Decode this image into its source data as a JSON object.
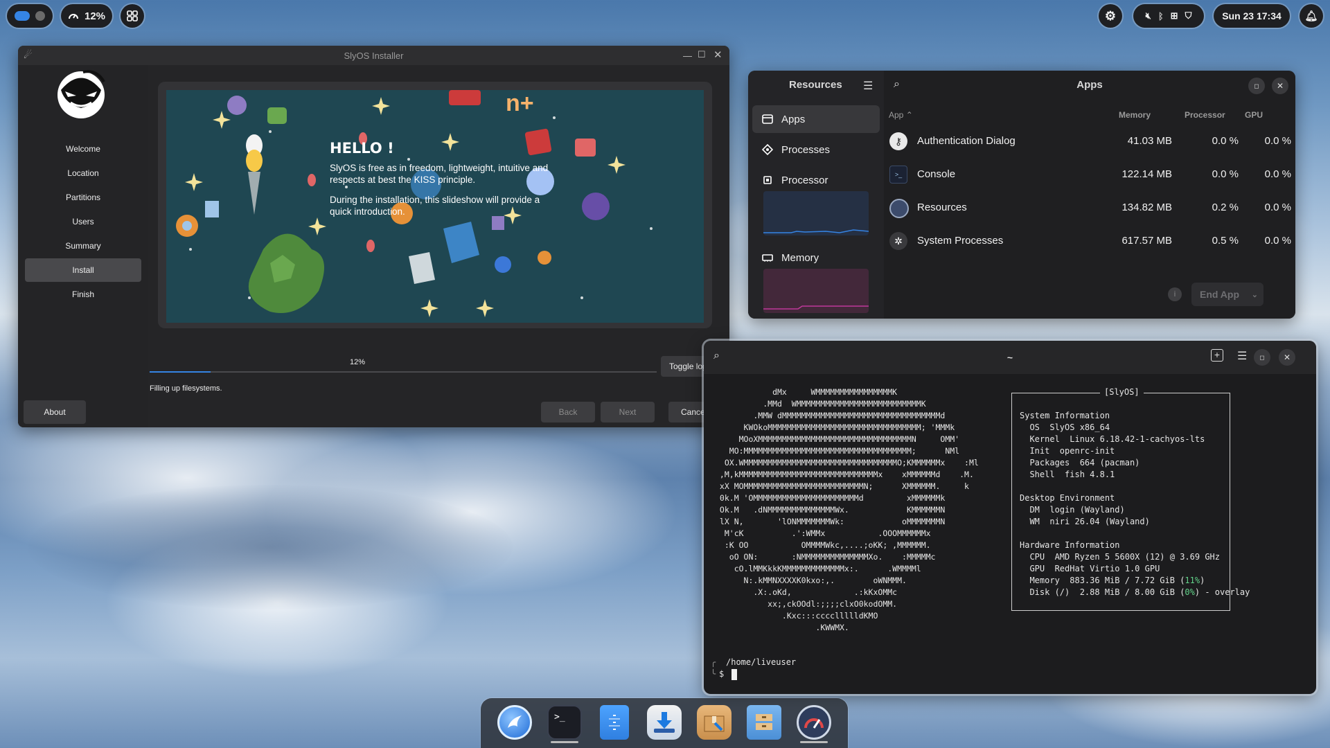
{
  "topbar": {
    "cpu_percent": "12%",
    "clock": "Sun 23 17:34"
  },
  "installer": {
    "title": "SlyOS Installer",
    "steps": [
      "Welcome",
      "Location",
      "Partitions",
      "Users",
      "Summary",
      "Install",
      "Finish"
    ],
    "active_step": "Install",
    "slide": {
      "heading": "HELLO !",
      "para1": "SlyOS is free as in freedom, lightweight, intuitive and respects at best the KISS principle.",
      "para2": "During the installation, this slideshow will provide a quick introduction."
    },
    "progress_label": "12%",
    "progress": 0.12,
    "status": "Filling up filesystems.",
    "toggle_log": "Toggle log",
    "about": "About",
    "back": "Back",
    "next": "Next",
    "cancel": "Cancel"
  },
  "resources": {
    "sidebar_title": "Resources",
    "main_title": "Apps",
    "nav": [
      "Apps",
      "Processes",
      "Processor",
      "Memory"
    ],
    "columns": {
      "app": "App",
      "memory": "Memory",
      "processor": "Processor",
      "gpu": "GPU"
    },
    "rows": [
      {
        "name": "Authentication Dialog",
        "memory": "41.03 MB",
        "processor": "0.0 %",
        "gpu": "0.0 %"
      },
      {
        "name": "Console",
        "memory": "122.14 MB",
        "processor": "0.0 %",
        "gpu": "0.0 %"
      },
      {
        "name": "Resources",
        "memory": "134.82 MB",
        "processor": "0.2 %",
        "gpu": "0.0 %"
      },
      {
        "name": "System Processes",
        "memory": "617.57 MB",
        "processor": "0.5 %",
        "gpu": "0.0 %"
      }
    ],
    "end_app": "End App"
  },
  "terminal": {
    "title": "~",
    "logo": "            dMx     WMMMMMMMMMMMMMMMMK\n          .MMd  WMMMMMMMMMMMMMMMMMMMMMMMMMMK\n        .MMW dMMMMMMMMMMMMMMMMMMMMMMMMMMMMMMMMMd\n      KWOkoMMMMMMMMMMMMMMMMMMMMMMMMMMMMMMMM; 'MMMk\n     MOoXMMMMMMMMMMMMMMMMMMMMMMMMMMMMMMMMN     OMM'\n   MO:MMMMMMMMMMMMMMMMMMMMMMMMMMMMMMMMMMM;      NMl\n  OX.WMMMMMMMMMMMMMMMMMMMMMMMMMMMMMMMMO;KMMMMMMx    :Ml\n ,M,kMMMMMMMMMMMMMMMMMMMMMMMMMMMMMx    xMMMMMMd    .M.\n xX MOMMMMMMMMMMMMMMMMMMMMMMMMMN;      XMMMMMM.     k\n 0k.M 'OMMMMMMMMMMMMMMMMMMMMMMd         xMMMMMMk\n Ok.M   .dNMMMMMMMMMMMMMMWx.            KMMMMMMN\n lX N,       'lONMMMMMMMWk:            oMMMMMMMN\n  M'cK          .':WMMx           .OOOMMMMMMx\n  :K OO           OMMMMWkc,....;oKK; ,MMMMMM.\n   oO ON:       :NMMMMMMMMMMMMMMXo.    :MMMMMc\n    cO.lMMKkkKMMMMMMMMMMMMMx:.      .WMMMMl\n      N:.kMMNXXXXK0kxo:,.        oWNMMM.\n        .X:.oKd,             .:kKxOMMc\n           xx;,ckOOdl:;;;;clxO0kodOMM.\n              .Kxc:::ccccllllldKMO\n                     .KWWMX.",
    "info_header": "[SlyOS]",
    "info": [
      {
        "t": "System Information"
      },
      {
        "k": "OS",
        "v": "SlyOS x86_64"
      },
      {
        "k": "Kernel",
        "v": "Linux 6.18.42-1-cachyos-lts"
      },
      {
        "k": "Init",
        "v": "openrc-init"
      },
      {
        "k": "Packages",
        "v": "664 (pacman)"
      },
      {
        "k": "Shell",
        "v": "fish 4.8.1"
      },
      {
        "t": ""
      },
      {
        "t": "Desktop Environment"
      },
      {
        "k": "DM",
        "v": "login (Wayland)"
      },
      {
        "k": "WM",
        "v": "niri 26.04 (Wayland)"
      },
      {
        "t": ""
      },
      {
        "t": "Hardware Information"
      },
      {
        "k": "CPU",
        "v": "AMD Ryzen 5 5600X (12) @ 3.69 GHz"
      },
      {
        "k": "GPU",
        "v": "RedHat Virtio 1.0 GPU"
      },
      {
        "k": "Memory",
        "v": "883.36 MiB / 7.72 GiB (",
        "hl": "11%",
        "post": ")"
      },
      {
        "k": "Disk (/)",
        "v": "2.88 MiB / 8.00 GiB (",
        "hl": "0%",
        "post": ") - overlay"
      }
    ],
    "cwd": "/home/liveuser",
    "prompt": "$"
  },
  "colors": {
    "accent": "#3584e4",
    "graph_cpu": "#2a3448",
    "graph_mem": "#4a2a3c",
    "green": "#62d38a"
  }
}
